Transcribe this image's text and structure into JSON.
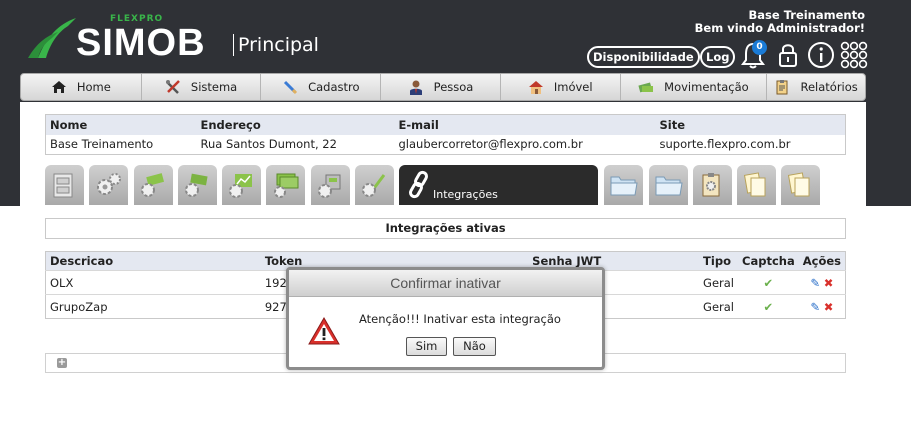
{
  "header": {
    "brand_small": "FLEXPRO",
    "brand": "SIMOB",
    "module": "Principal",
    "account_name": "Base Treinamento",
    "welcome": "Bem vindo Administrador!",
    "disponibilidade_label": "Disponibilidade",
    "log_label": "Log",
    "notification_count": "0"
  },
  "nav": {
    "items": [
      {
        "label": "Home",
        "icon": "home-icon"
      },
      {
        "label": "Sistema",
        "icon": "tools-icon"
      },
      {
        "label": "Cadastro",
        "icon": "pencil-icon"
      },
      {
        "label": "Pessoa",
        "icon": "person-icon"
      },
      {
        "label": "Imóvel",
        "icon": "house-icon"
      },
      {
        "label": "Movimentação",
        "icon": "money-icon"
      },
      {
        "label": "Relatórios",
        "icon": "clipboard-icon"
      }
    ]
  },
  "info_table": {
    "headers": {
      "nome": "Nome",
      "endereco": "Endereço",
      "email": "E-mail",
      "site": "Site"
    },
    "row": {
      "nome": "Base Treinamento",
      "endereco": "Rua Santos Dumont, 22",
      "email": "glaubercorretor@flexpro.com.br",
      "site": "suporte.flexpro.com.br"
    }
  },
  "tabs": {
    "active_label": "Integrações"
  },
  "integrations": {
    "section_title": "Integrações ativas",
    "headers": {
      "descricao": "Descricao",
      "token": "Token",
      "senha": "Senha JWT",
      "tipo": "Tipo",
      "captcha": "Captcha",
      "acoes": "Ações"
    },
    "rows": [
      {
        "descricao": "OLX",
        "token": "192",
        "tipo": "Geral"
      },
      {
        "descricao": "GrupoZap",
        "token": "927",
        "tipo": "Geral"
      }
    ]
  },
  "modal": {
    "title": "Confirmar inativar",
    "message": "Atenção!!! Inativar esta integração",
    "yes_label": "Sim",
    "no_label": "Não"
  },
  "colors": {
    "header_bg": "#2f3136",
    "brand_green": "#39b54a",
    "badge_blue": "#1a7bd6",
    "table_header_bg": "#e4e8f1"
  }
}
